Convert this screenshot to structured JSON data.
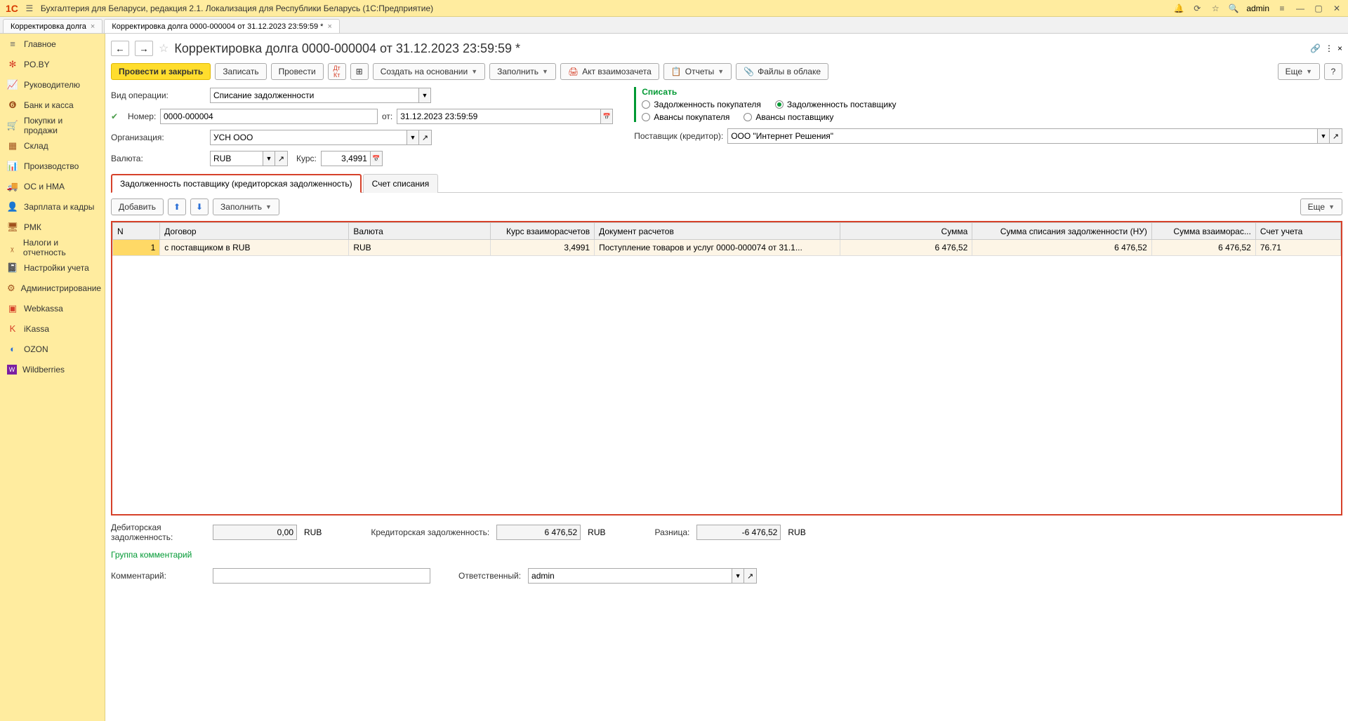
{
  "titlebar": {
    "logo": "1C",
    "title": "Бухгалтерия для Беларуси, редакция 2.1. Локализация для Республики Беларусь   (1С:Предприятие)",
    "user": "admin"
  },
  "wintabs": [
    {
      "label": "Корректировка долга"
    },
    {
      "label": "Корректировка долга 0000-000004 от 31.12.2023 23:59:59 *"
    }
  ],
  "sidebar": [
    {
      "label": "Главное"
    },
    {
      "label": "PO.BY"
    },
    {
      "label": "Руководителю"
    },
    {
      "label": "Банк и касса"
    },
    {
      "label": "Покупки и продажи"
    },
    {
      "label": "Склад"
    },
    {
      "label": "Производство"
    },
    {
      "label": "ОС и НМА"
    },
    {
      "label": "Зарплата и кадры"
    },
    {
      "label": "РМК"
    },
    {
      "label": "Налоги и отчетность"
    },
    {
      "label": "Настройки учета"
    },
    {
      "label": "Администрирование"
    },
    {
      "label": "Webkassa"
    },
    {
      "label": "iKassa"
    },
    {
      "label": "OZON"
    },
    {
      "label": "Wildberries"
    }
  ],
  "page": {
    "title": "Корректировка долга 0000-000004 от 31.12.2023 23:59:59 *"
  },
  "toolbar": {
    "post_close": "Провести и закрыть",
    "save": "Записать",
    "post": "Провести",
    "create_based": "Создать на основании",
    "fill": "Заполнить",
    "act": "Акт взаимозачета",
    "reports": "Отчеты",
    "cloud": "Файлы в облаке",
    "more": "Еще"
  },
  "form": {
    "op_label": "Вид операции:",
    "op_value": "Списание задолженности",
    "num_label": "Номер:",
    "num_value": "0000-000004",
    "from_label": "от:",
    "date_value": "31.12.2023 23:59:59",
    "org_label": "Организация:",
    "org_value": "УСН ООО",
    "cur_label": "Валюта:",
    "cur_value": "RUB",
    "rate_label": "Курс:",
    "rate_value": "3,4991",
    "writeoff_title": "Списать",
    "radio1": "Задолженность покупателя",
    "radio2": "Задолженность поставщику",
    "radio3": "Авансы покупателя",
    "radio4": "Авансы поставщику",
    "supplier_label": "Поставщик (кредитор):",
    "supplier_value": "ООО \"Интернет Решения\""
  },
  "subtabs": {
    "tab1": "Задолженность поставщику (кредиторская задолженность)",
    "tab2": "Счет списания"
  },
  "table_tb": {
    "add": "Добавить",
    "fill": "Заполнить",
    "more": "Еще"
  },
  "grid": {
    "headers": {
      "n": "N",
      "contract": "Договор",
      "currency": "Валюта",
      "rate": "Курс взаиморасчетов",
      "doc": "Документ расчетов",
      "sum": "Сумма",
      "sum_nu": "Сумма списания задолженности (НУ)",
      "sum_vzr": "Сумма взаиморас...",
      "account": "Счет учета"
    },
    "row": {
      "n": "1",
      "contract": "с поставщиком в RUB",
      "currency": "RUB",
      "rate": "3,4991",
      "doc": "Поступление товаров и услуг 0000-000074 от 31.1...",
      "sum": "6 476,52",
      "sum_nu": "6 476,52",
      "sum_vzr": "6 476,52",
      "account": "76.71"
    }
  },
  "bottom": {
    "deb_label": "Дебиторская задолженность:",
    "deb_value": "0,00",
    "deb_cur": "RUB",
    "cred_label": "Кредиторская задолженность:",
    "cred_value": "6 476,52",
    "cred_cur": "RUB",
    "diff_label": "Разница:",
    "diff_value": "-6 476,52",
    "diff_cur": "RUB",
    "comment_group": "Группа комментарий",
    "comment_label": "Комментарий:",
    "resp_label": "Ответственный:",
    "resp_value": "admin"
  }
}
